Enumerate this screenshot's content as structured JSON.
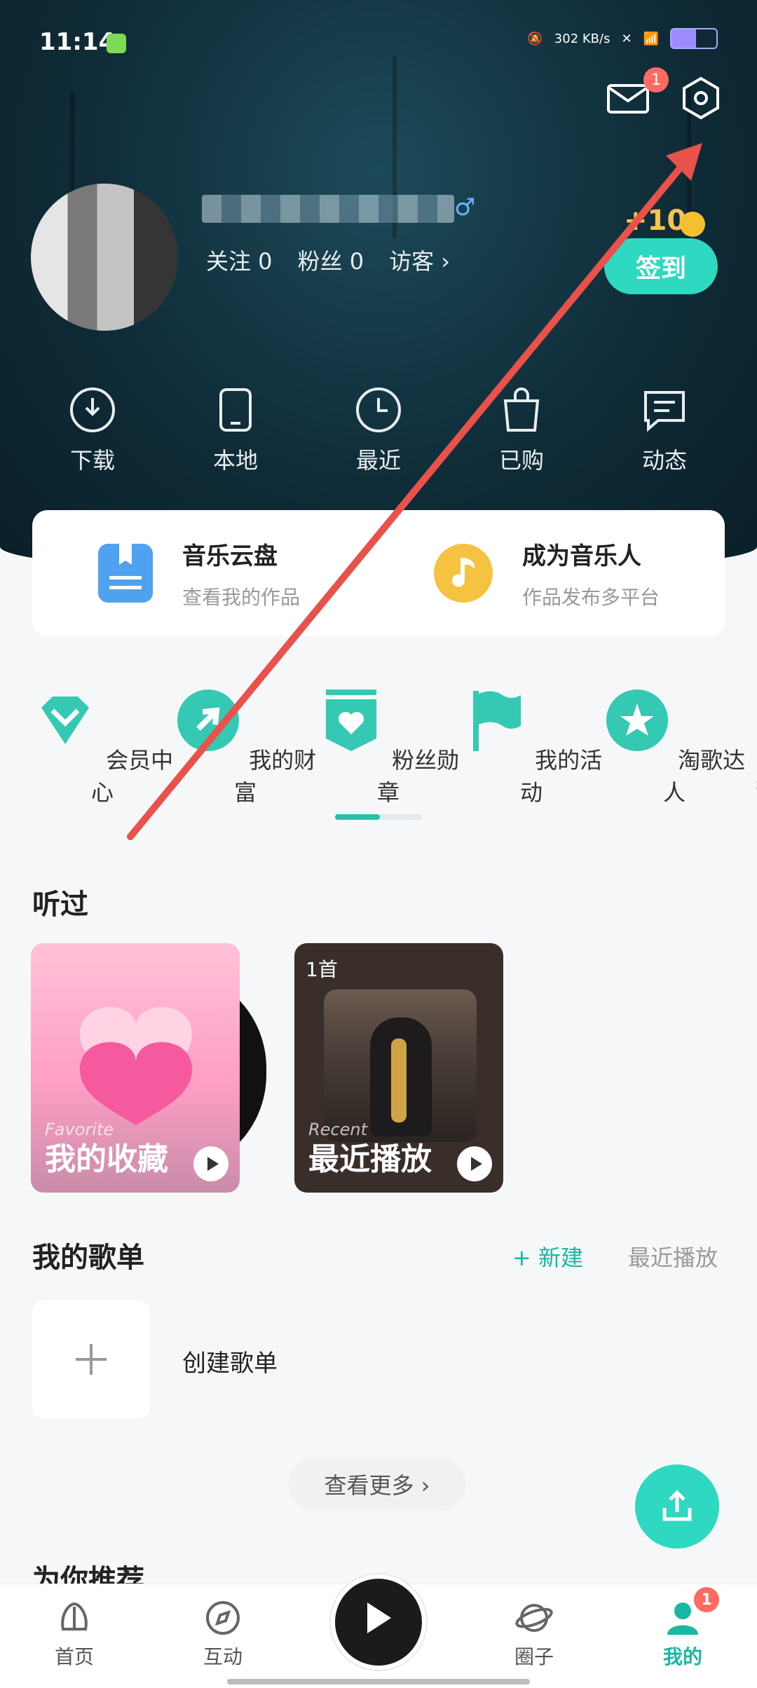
{
  "status_bar": {
    "time": "11:14",
    "net_speed": "302 KB/s"
  },
  "top_actions": {
    "mail_badge": "1"
  },
  "profile": {
    "gender_symbol": "♂",
    "stats": {
      "following": "关注 0",
      "fans": "粉丝 0",
      "visitors": "访客 ›"
    },
    "coin_reward": "+10",
    "signin_label": "签到"
  },
  "quick_actions": [
    {
      "label": "下载",
      "icon": "download-icon"
    },
    {
      "label": "本地",
      "icon": "phone-icon"
    },
    {
      "label": "最近",
      "icon": "clock-icon"
    },
    {
      "label": "已购",
      "icon": "bag-icon"
    },
    {
      "label": "动态",
      "icon": "message-icon"
    }
  ],
  "cloud_card": {
    "left": {
      "title": "音乐云盘",
      "subtitle": "查看我的作品"
    },
    "right": {
      "title": "成为音乐人",
      "subtitle": "作品发布多平台"
    }
  },
  "features": [
    {
      "label": "会员中心",
      "icon": "vip-diamond-icon"
    },
    {
      "label": "我的财富",
      "icon": "wealth-icon"
    },
    {
      "label": "粉丝勋章",
      "icon": "fan-badge-icon"
    },
    {
      "label": "我的活动",
      "icon": "flag-icon"
    },
    {
      "label": "淘歌达人",
      "icon": "star-badge-icon"
    },
    {
      "label": "我",
      "icon": "more-icon"
    }
  ],
  "listened": {
    "title": "听过",
    "favorite": {
      "en": "Favorite",
      "label": "我的收藏"
    },
    "recent": {
      "count": "1首",
      "en": "Recent",
      "label": "最近播放"
    }
  },
  "playlists": {
    "title": "我的歌单",
    "new_label": "+ 新建",
    "recent_label": "最近播放",
    "create_label": "创建歌单",
    "more_label": "查看更多 ›"
  },
  "recommend": {
    "title": "为你推荐"
  },
  "bottom_nav": [
    {
      "label": "首页",
      "icon": "home-leaf-icon"
    },
    {
      "label": "互动",
      "icon": "compass-icon"
    },
    {
      "label": "圈子",
      "icon": "planet-icon"
    },
    {
      "label": "我的",
      "icon": "user-icon",
      "badge": "1"
    }
  ],
  "colors": {
    "accent": "#2fd8c0",
    "badge": "#ff6b5e",
    "hero": "#0f2c38"
  }
}
